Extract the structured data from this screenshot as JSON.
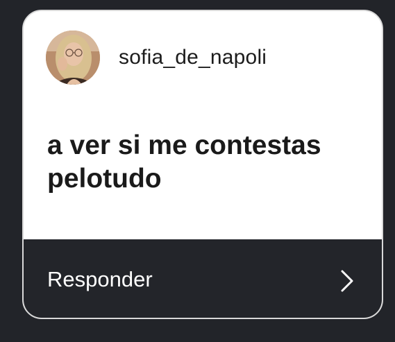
{
  "story_reply": {
    "username": "sofia_de_napoli",
    "message": "a ver si me contestas pelotudo",
    "reply_label": "Responder",
    "avatar_icon": "profile-photo",
    "chevron_icon": "chevron-right-icon"
  },
  "colors": {
    "background": "#222429",
    "card": "#ffffff",
    "reply_bar": "#23252a",
    "text_dark": "#1a1a1a",
    "text_light": "#ffffff"
  }
}
